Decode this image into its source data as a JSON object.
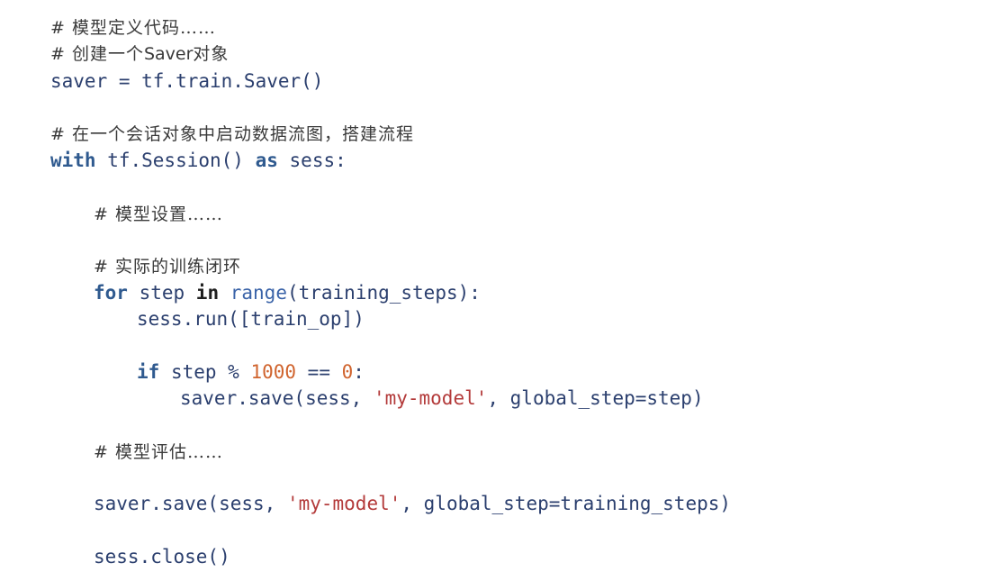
{
  "code": {
    "lines": [
      {
        "tokens": [
          {
            "t": "# 模型定义代码……",
            "k": "cm"
          }
        ]
      },
      {
        "tokens": [
          {
            "t": "# 创建一个",
            "k": "cm"
          },
          {
            "t": "Saver",
            "k": "cm-latin"
          },
          {
            "t": "对象",
            "k": "cm"
          }
        ]
      },
      {
        "tokens": [
          {
            "t": "saver = tf.train.Saver()",
            "k": "p"
          }
        ]
      },
      {
        "tokens": [
          {
            "t": "# 在一个会话对象中启动数据流图，搭建流程",
            "k": "cm"
          }
        ]
      },
      {
        "tokens": [
          {
            "t": "with",
            "k": "kw"
          },
          {
            "t": " tf.Session() ",
            "k": "p"
          },
          {
            "t": "as",
            "k": "kw"
          },
          {
            "t": " sess:",
            "k": "p"
          }
        ]
      },
      {
        "tokens": [
          {
            "t": "# 模型设置……",
            "k": "cm"
          }
        ]
      },
      {
        "tokens": [
          {
            "t": "# 实际的训练闭环",
            "k": "cm"
          }
        ]
      },
      {
        "tokens": [
          {
            "t": "for",
            "k": "kw"
          },
          {
            "t": " step ",
            "k": "p"
          },
          {
            "t": "in",
            "k": "in"
          },
          {
            "t": " ",
            "k": "p"
          },
          {
            "t": "range",
            "k": "bi"
          },
          {
            "t": "(training_steps):",
            "k": "p"
          }
        ]
      },
      {
        "tokens": [
          {
            "t": "sess.run([train_op])",
            "k": "p"
          }
        ]
      },
      {
        "tokens": [
          {
            "t": "if",
            "k": "kw"
          },
          {
            "t": " step % ",
            "k": "p"
          },
          {
            "t": "1000",
            "k": "num"
          },
          {
            "t": " == ",
            "k": "p"
          },
          {
            "t": "0",
            "k": "num"
          },
          {
            "t": ":",
            "k": "p"
          }
        ]
      },
      {
        "tokens": [
          {
            "t": "saver.save(sess, ",
            "k": "p"
          },
          {
            "t": "'my-model'",
            "k": "str"
          },
          {
            "t": ", global_step=step)",
            "k": "p"
          }
        ]
      },
      {
        "tokens": [
          {
            "t": "# 模型评估……",
            "k": "cm"
          }
        ]
      },
      {
        "tokens": [
          {
            "t": "saver.save(sess, ",
            "k": "p"
          },
          {
            "t": "'my-model'",
            "k": "str"
          },
          {
            "t": ", global_step=training_steps)",
            "k": "p"
          }
        ]
      },
      {
        "tokens": [
          {
            "t": "sess.close()",
            "k": "p"
          }
        ]
      }
    ]
  },
  "colors": {
    "plain": "#2b3f6e",
    "keyword": "#2f5a8f",
    "string": "#b33a3a",
    "number": "#d0642e",
    "comment": "#3a3a3a",
    "background": "#ffffff"
  }
}
